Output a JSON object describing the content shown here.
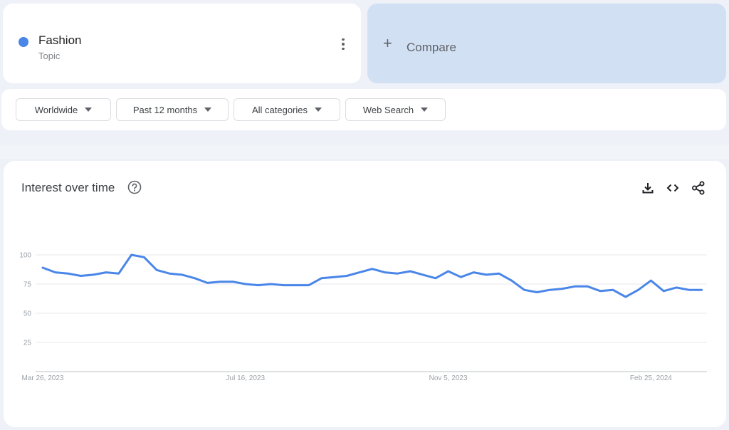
{
  "topic_card": {
    "name": "Fashion",
    "type": "Topic",
    "color": "#4a86e8",
    "more_icon": "more-vert-icon"
  },
  "compare": {
    "icon": "plus-icon",
    "label": "Compare"
  },
  "filters": [
    {
      "label": "Worldwide",
      "icon": "caret-down-icon"
    },
    {
      "label": "Past 12 months",
      "icon": "caret-down-icon"
    },
    {
      "label": "All categories",
      "icon": "caret-down-icon"
    },
    {
      "label": "Web Search",
      "icon": "caret-down-icon"
    }
  ],
  "interest_panel": {
    "title": "Interest over time",
    "help_icon": "help-circle-icon",
    "actions": [
      {
        "name": "download-icon",
        "label": "Download CSV"
      },
      {
        "name": "embed-icon",
        "label": "Embed"
      },
      {
        "name": "share-icon",
        "label": "Share"
      }
    ]
  },
  "chart_data": {
    "type": "line",
    "title": "Interest over time",
    "xlabel": "",
    "ylabel": "",
    "ylim": [
      0,
      100
    ],
    "yticks": [
      25,
      50,
      75,
      100
    ],
    "grid": true,
    "x_tick_labels": [
      {
        "label": "Mar 26, 2023",
        "index": 0
      },
      {
        "label": "Jul 16, 2023",
        "index": 16
      },
      {
        "label": "Nov 5, 2023",
        "index": 32
      },
      {
        "label": "Feb 25, 2024",
        "index": 48
      }
    ],
    "x_interval": "weekly",
    "series": [
      {
        "name": "Fashion",
        "color": "#4a86e8",
        "values": [
          89,
          85,
          84,
          82,
          83,
          85,
          84,
          100,
          98,
          87,
          84,
          83,
          80,
          76,
          77,
          77,
          75,
          74,
          75,
          74,
          74,
          74,
          80,
          81,
          82,
          85,
          88,
          85,
          84,
          86,
          83,
          80,
          86,
          81,
          85,
          83,
          84,
          78,
          70,
          68,
          70,
          71,
          73,
          73,
          69,
          70,
          64,
          70,
          78,
          69,
          72,
          70,
          70
        ]
      }
    ]
  }
}
